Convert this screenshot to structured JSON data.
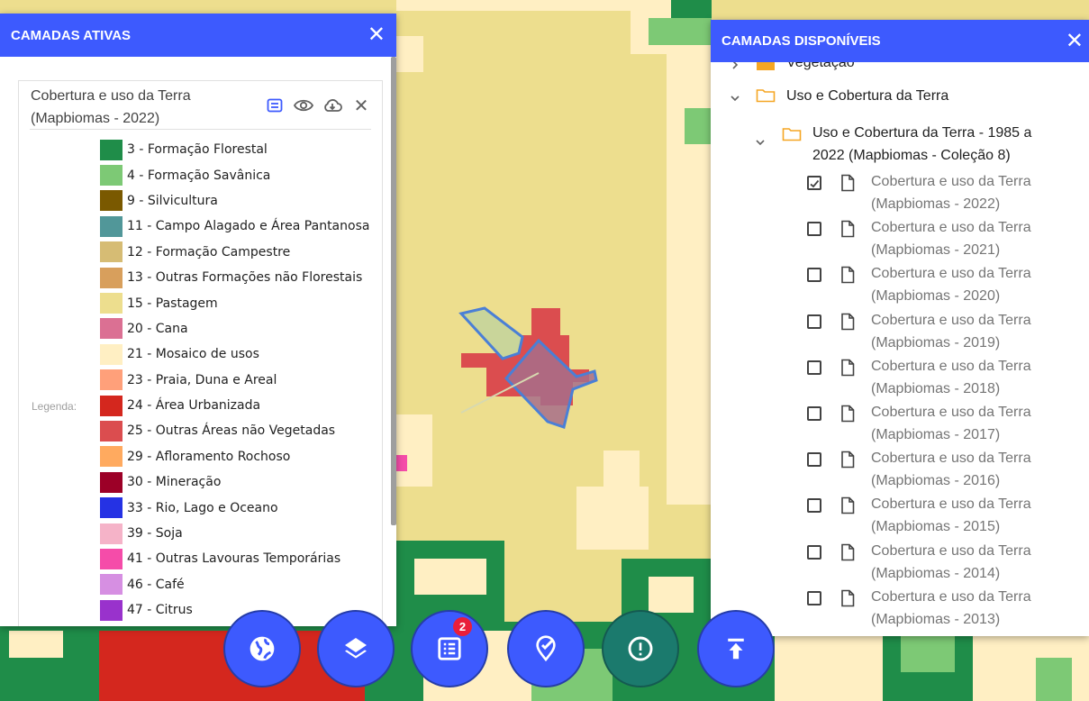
{
  "colors": {
    "accent": "#3d5afe",
    "teal": "#1b7a6d",
    "badge": "#e91e3a",
    "folder": "#f5a623"
  },
  "left_panel": {
    "title": "CAMADAS ATIVAS",
    "layer_title_line1": "Cobertura e uso da Terra",
    "layer_title_line2": "(Mapbiomas - 2022)",
    "icons": [
      "legend-icon",
      "eye-icon",
      "cloud-download-icon",
      "close-icon"
    ],
    "legend_label": "Legenda:",
    "legend": [
      {
        "label": "3 - Formação Florestal",
        "color": "#1f8d49"
      },
      {
        "label": "4 - Formação Savânica",
        "color": "#7dc975"
      },
      {
        "label": "9 - Silvicultura",
        "color": "#7a5900"
      },
      {
        "label": "11 - Campo Alagado e Área Pantanosa",
        "color": "#519799"
      },
      {
        "label": "12 - Formação Campestre",
        "color": "#d6bc74"
      },
      {
        "label": "13 - Outras Formações não Florestais",
        "color": "#d89f5c"
      },
      {
        "label": "15 - Pastagem",
        "color": "#edde8e"
      },
      {
        "label": "20 - Cana",
        "color": "#db7093"
      },
      {
        "label": "21 - Mosaico de usos",
        "color": "#ffefc3"
      },
      {
        "label": "23 - Praia, Duna e Areal",
        "color": "#ffa07a"
      },
      {
        "label": "24 - Área Urbanizada",
        "color": "#d4271e"
      },
      {
        "label": "25 - Outras Áreas não Vegetadas",
        "color": "#db4d4f"
      },
      {
        "label": "29 - Afloramento Rochoso",
        "color": "#ffaa5f"
      },
      {
        "label": "30 - Mineração",
        "color": "#9c0027"
      },
      {
        "label": "33 - Rio, Lago e Oceano",
        "color": "#2532e4"
      },
      {
        "label": "39 - Soja",
        "color": "#f5b3c8"
      },
      {
        "label": "41 - Outras Lavouras Temporárias",
        "color": "#f54ca9"
      },
      {
        "label": "46 - Café",
        "color": "#d68fe2"
      },
      {
        "label": "47 - Citrus",
        "color": "#9932cc"
      }
    ]
  },
  "right_panel": {
    "title": "CAMADAS DISPONÍVEIS",
    "partial_folder": "Vegetação",
    "folder_1": "Uso e Cobertura da Terra",
    "folder_2_line1": "Uso e Cobertura da Terra - 1985 a",
    "folder_2_line2": "2022 (Mapbiomas - Coleção 8)",
    "layers": [
      {
        "line1": "Cobertura e uso da Terra",
        "line2": "(Mapbiomas - 2022)",
        "checked": true
      },
      {
        "line1": "Cobertura e uso da Terra",
        "line2": "(Mapbiomas - 2021)",
        "checked": false
      },
      {
        "line1": "Cobertura e uso da Terra",
        "line2": "(Mapbiomas - 2020)",
        "checked": false
      },
      {
        "line1": "Cobertura e uso da Terra",
        "line2": "(Mapbiomas - 2019)",
        "checked": false
      },
      {
        "line1": "Cobertura e uso da Terra",
        "line2": "(Mapbiomas - 2018)",
        "checked": false
      },
      {
        "line1": "Cobertura e uso da Terra",
        "line2": "(Mapbiomas - 2017)",
        "checked": false
      },
      {
        "line1": "Cobertura e uso da Terra",
        "line2": "(Mapbiomas - 2016)",
        "checked": false
      },
      {
        "line1": "Cobertura e uso da Terra",
        "line2": "(Mapbiomas - 2015)",
        "checked": false
      },
      {
        "line1": "Cobertura e uso da Terra",
        "line2": "(Mapbiomas - 2014)",
        "checked": false
      },
      {
        "line1": "Cobertura e uso da Terra",
        "line2": "(Mapbiomas - 2013)",
        "checked": false
      }
    ]
  },
  "bottom_bar": {
    "buttons": [
      "globe-icon",
      "layers-icon",
      "list-icon",
      "map-marker-check-icon",
      "alert-circle-icon",
      "upload-icon"
    ],
    "list_badge": "2"
  }
}
